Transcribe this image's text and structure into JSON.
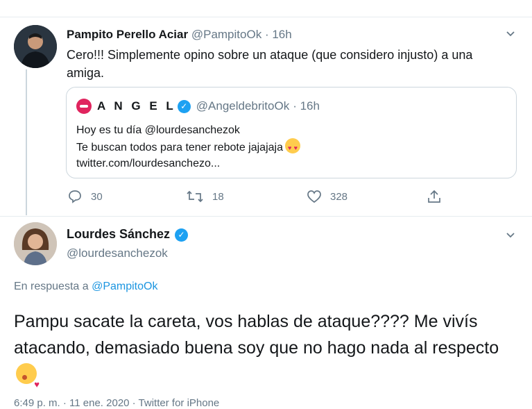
{
  "tweet1": {
    "name": "Pampito Perello Aciar",
    "handle": "@PampitoOk",
    "time": "· 16h",
    "text": "Cero!!! Simplemente opino sobre un ataque (que considero injusto) a una amiga.",
    "quote": {
      "name": "A N G E L",
      "handle": "@AngeldebritoOk",
      "time": "· 16h",
      "line1": "Hoy es tu día @lourdesanchezok",
      "line2": "Te buscan todos para tener rebote jajajaja",
      "line3": "twitter.com/lourdesanchezo..."
    },
    "actions": {
      "replies": "30",
      "retweets": "18",
      "likes": "328"
    }
  },
  "tweet2": {
    "name": "Lourdes Sánchez",
    "handle": "@lourdesanchezok",
    "reply_prefix": "En respuesta a",
    "reply_to": "@PampitoOk",
    "text": "Pampu sacate la careta, vos hablas de ataque???? Me vivís atacando, demasiado buena soy que no hago nada al respecto",
    "footer": "6:49 p. m. · 11 ene. 2020 · Twitter for iPhone"
  },
  "icons": [
    "chevron-down-icon",
    "verified-badge-icon",
    "reply-icon",
    "retweet-icon",
    "like-icon",
    "share-icon",
    "heart-eyes-emoji",
    "kiss-emoji"
  ],
  "colors": {
    "accent": "#1da1f2",
    "link": "#1b95e0",
    "muted": "#657786",
    "border": "#ccd6dd"
  }
}
